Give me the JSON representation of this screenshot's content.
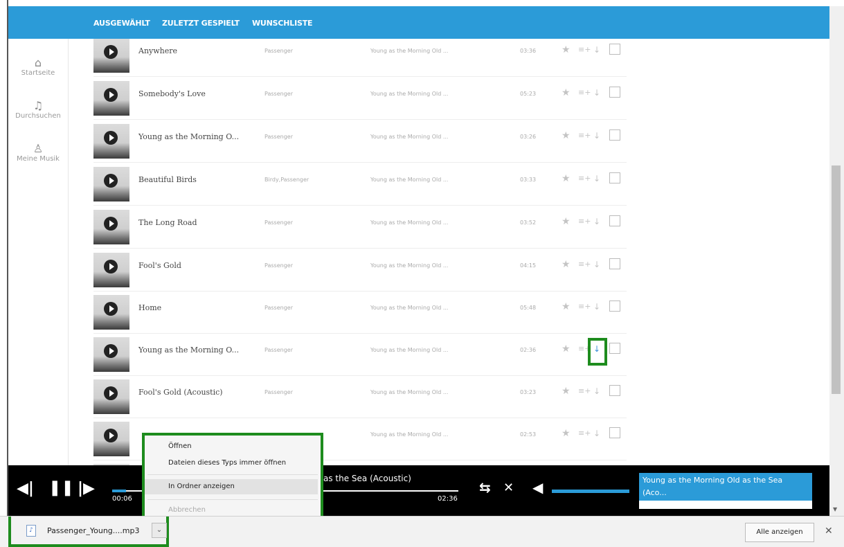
{
  "nav": {
    "tabs": [
      "AUSGEWÄHLT",
      "ZULETZT GESPIELT",
      "WUNSCHLISTE"
    ]
  },
  "sidebar": {
    "items": [
      {
        "label": "Startseite",
        "icon": "home-icon"
      },
      {
        "label": "Durchsuchen",
        "icon": "music-note-icon"
      },
      {
        "label": "Meine Musik",
        "icon": "person-icon"
      }
    ]
  },
  "tracks": [
    {
      "title": "Anywhere",
      "artist": "Passenger",
      "album": "Young as the Morning Old ...",
      "duration": "03:36"
    },
    {
      "title": "Somebody's Love",
      "artist": "Passenger",
      "album": "Young as the Morning Old ...",
      "duration": "05:23"
    },
    {
      "title": "Young as the Morning O...",
      "artist": "Passenger",
      "album": "Young as the Morning Old ...",
      "duration": "03:26"
    },
    {
      "title": "Beautiful Birds",
      "artist": "Birdy,Passenger",
      "album": "Young as the Morning Old ...",
      "duration": "03:33"
    },
    {
      "title": "The Long Road",
      "artist": "Passenger",
      "album": "Young as the Morning Old ...",
      "duration": "03:52"
    },
    {
      "title": "Fool's Gold",
      "artist": "Passenger",
      "album": "Young as the Morning Old ...",
      "duration": "04:15"
    },
    {
      "title": "Home",
      "artist": "Passenger",
      "album": "Young as the Morning Old ...",
      "duration": "05:48"
    },
    {
      "title": "Young as the Morning O...",
      "artist": "Passenger",
      "album": "Young as the Morning Old ...",
      "duration": "02:36"
    },
    {
      "title": "Fool's Gold (Acoustic)",
      "artist": "Passenger",
      "album": "Young as the Morning Old ...",
      "duration": "03:23"
    },
    {
      "title": "",
      "artist": "",
      "album": "Young as the Morning Old ...",
      "duration": "02:53"
    }
  ],
  "player": {
    "elapsed": "00:06",
    "total": "02:36",
    "now_playing_fragment": "as the Sea (Acoustic)",
    "now_playing_full": "Young as the Morning Old as the Sea (Aco...",
    "progress": 0.04
  },
  "context_menu": {
    "items": [
      "Öffnen",
      "Dateien dieses Typs immer öffnen",
      "In Ordner anzeigen",
      "Abbrechen"
    ]
  },
  "download_bar": {
    "filename": "Passenger_Young....mp3",
    "show_all": "Alle anzeigen",
    "close": "✕"
  },
  "colors": {
    "accent": "#2b9bd8",
    "highlight_border": "#1e8c1e",
    "player_bg": "#000000"
  }
}
